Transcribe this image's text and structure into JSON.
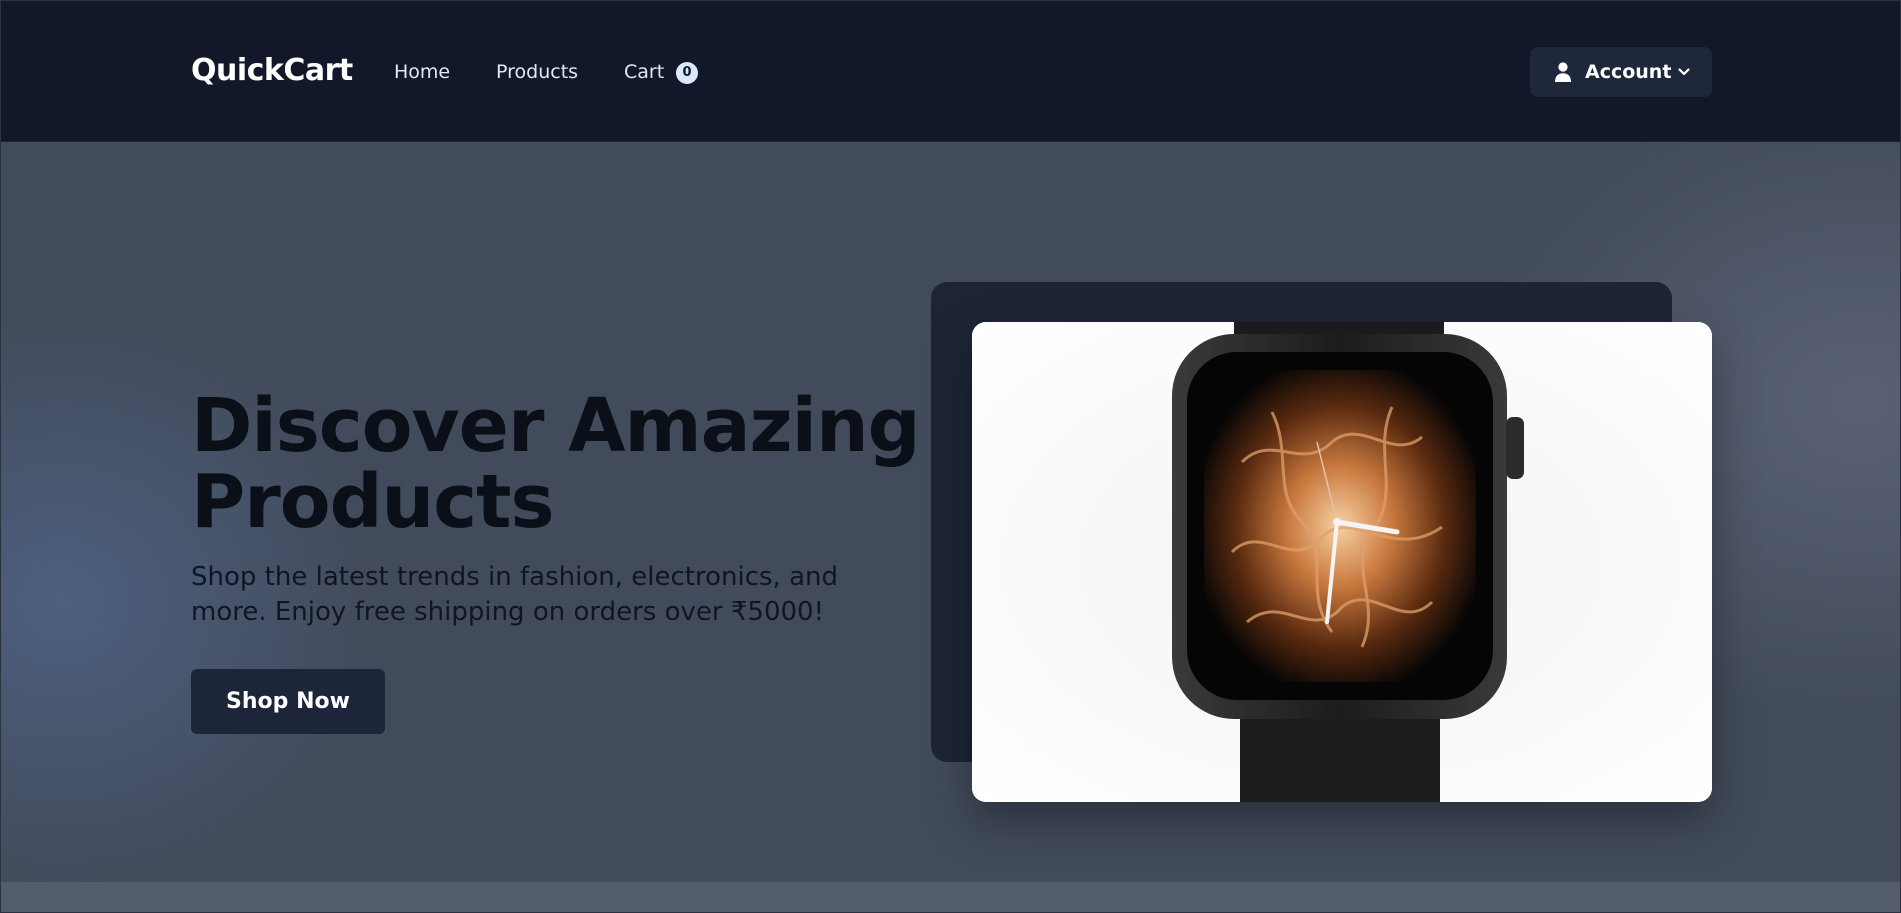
{
  "header": {
    "logo": "QuickCart",
    "nav": {
      "home": "Home",
      "products": "Products",
      "cart": "Cart",
      "cart_count": "0"
    },
    "account_label": "Account",
    "icons": {
      "account": "user-icon",
      "dropdown": "chevron-down-icon"
    }
  },
  "hero": {
    "title_line1": "Discover Amazing",
    "title_line2": "Products",
    "subtitle_line1": "Shop the latest trends in fashion, electronics, and",
    "subtitle_line2": "more. Enjoy free shipping on orders over ₹5000!",
    "cta": "Shop Now",
    "image": "smartwatch-photo"
  },
  "colors": {
    "header_bg": "#121829",
    "hero_bg": "#424b5b",
    "button_bg": "#1c2539",
    "badge_bg": "#dbe8ff"
  }
}
